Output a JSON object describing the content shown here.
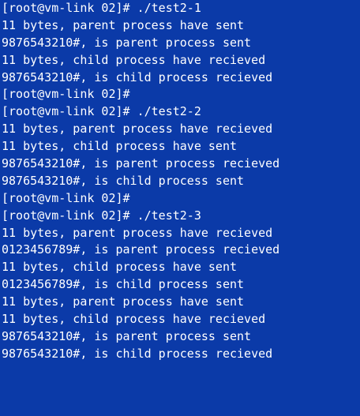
{
  "terminal": {
    "background": "#0b3aa8",
    "foreground": "#ffffff",
    "lines": [
      "[root@vm-link 02]# ./test2-1",
      "11 bytes, parent process have sent",
      "9876543210#, is parent process sent",
      "11 bytes, child process have recieved",
      "9876543210#, is child process recieved",
      "[root@vm-link 02]#",
      "[root@vm-link 02]# ./test2-2",
      "11 bytes, parent process have recieved",
      "11 bytes, child process have sent",
      "9876543210#, is parent process recieved",
      "9876543210#, is child process sent",
      "[root@vm-link 02]#",
      "[root@vm-link 02]# ./test2-3",
      "11 bytes, parent process have recieved",
      "0123456789#, is parent process recieved",
      "11 bytes, child process have sent",
      "0123456789#, is child process sent",
      "11 bytes, parent process have sent",
      "11 bytes, child process have recieved",
      "9876543210#, is parent process sent",
      "9876543210#, is child process recieved"
    ]
  }
}
